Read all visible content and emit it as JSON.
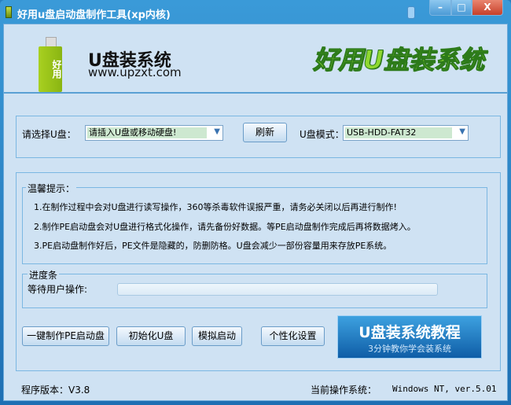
{
  "window": {
    "title": "好用u盘启动盘制作工具(xp内核)",
    "minimize": "–",
    "maximize": "□",
    "close": "X"
  },
  "header": {
    "usb_label": "好用",
    "brand": "U盘装系统",
    "site": "www.upzxt.com",
    "slogan": "好用U盘装系统"
  },
  "select": {
    "disk_label": "请选择U盘：",
    "disk_value": "请插入U盘或移动硬盘!",
    "refresh": "刷新",
    "mode_label": "U盘模式：",
    "mode_value": "USB-HDD-FAT32"
  },
  "tips": {
    "title": "温馨提示：",
    "items": [
      "1.在制作过程中会对U盘进行读写操作，360等杀毒软件误报严重，请务必关闭以后再进行制作!",
      "2.制作PE启动盘会对U盘进行格式化操作，请先备份好数据。等PE启动盘制作完成后再将数据烤入。",
      "3.PE启动盘制作好后，PE文件是隐藏的，防删防格。U盘会减少一部份容量用来存放PE系统。"
    ]
  },
  "progress": {
    "title": "进度条",
    "status": "等待用户操作:",
    "value": 0
  },
  "buttons": {
    "make": "一键制作PE启动盘",
    "init": "初始化U盘",
    "simulate": "模拟启动",
    "custom": "个性化设置",
    "tutorial_title": "U盘装系统教程",
    "tutorial_sub": "3分钟教你学会装系统"
  },
  "footer": {
    "version_label": "程序版本：V3.8",
    "os_label": "当前操作系统：",
    "os_value": "Windows NT, ver.5.01"
  }
}
